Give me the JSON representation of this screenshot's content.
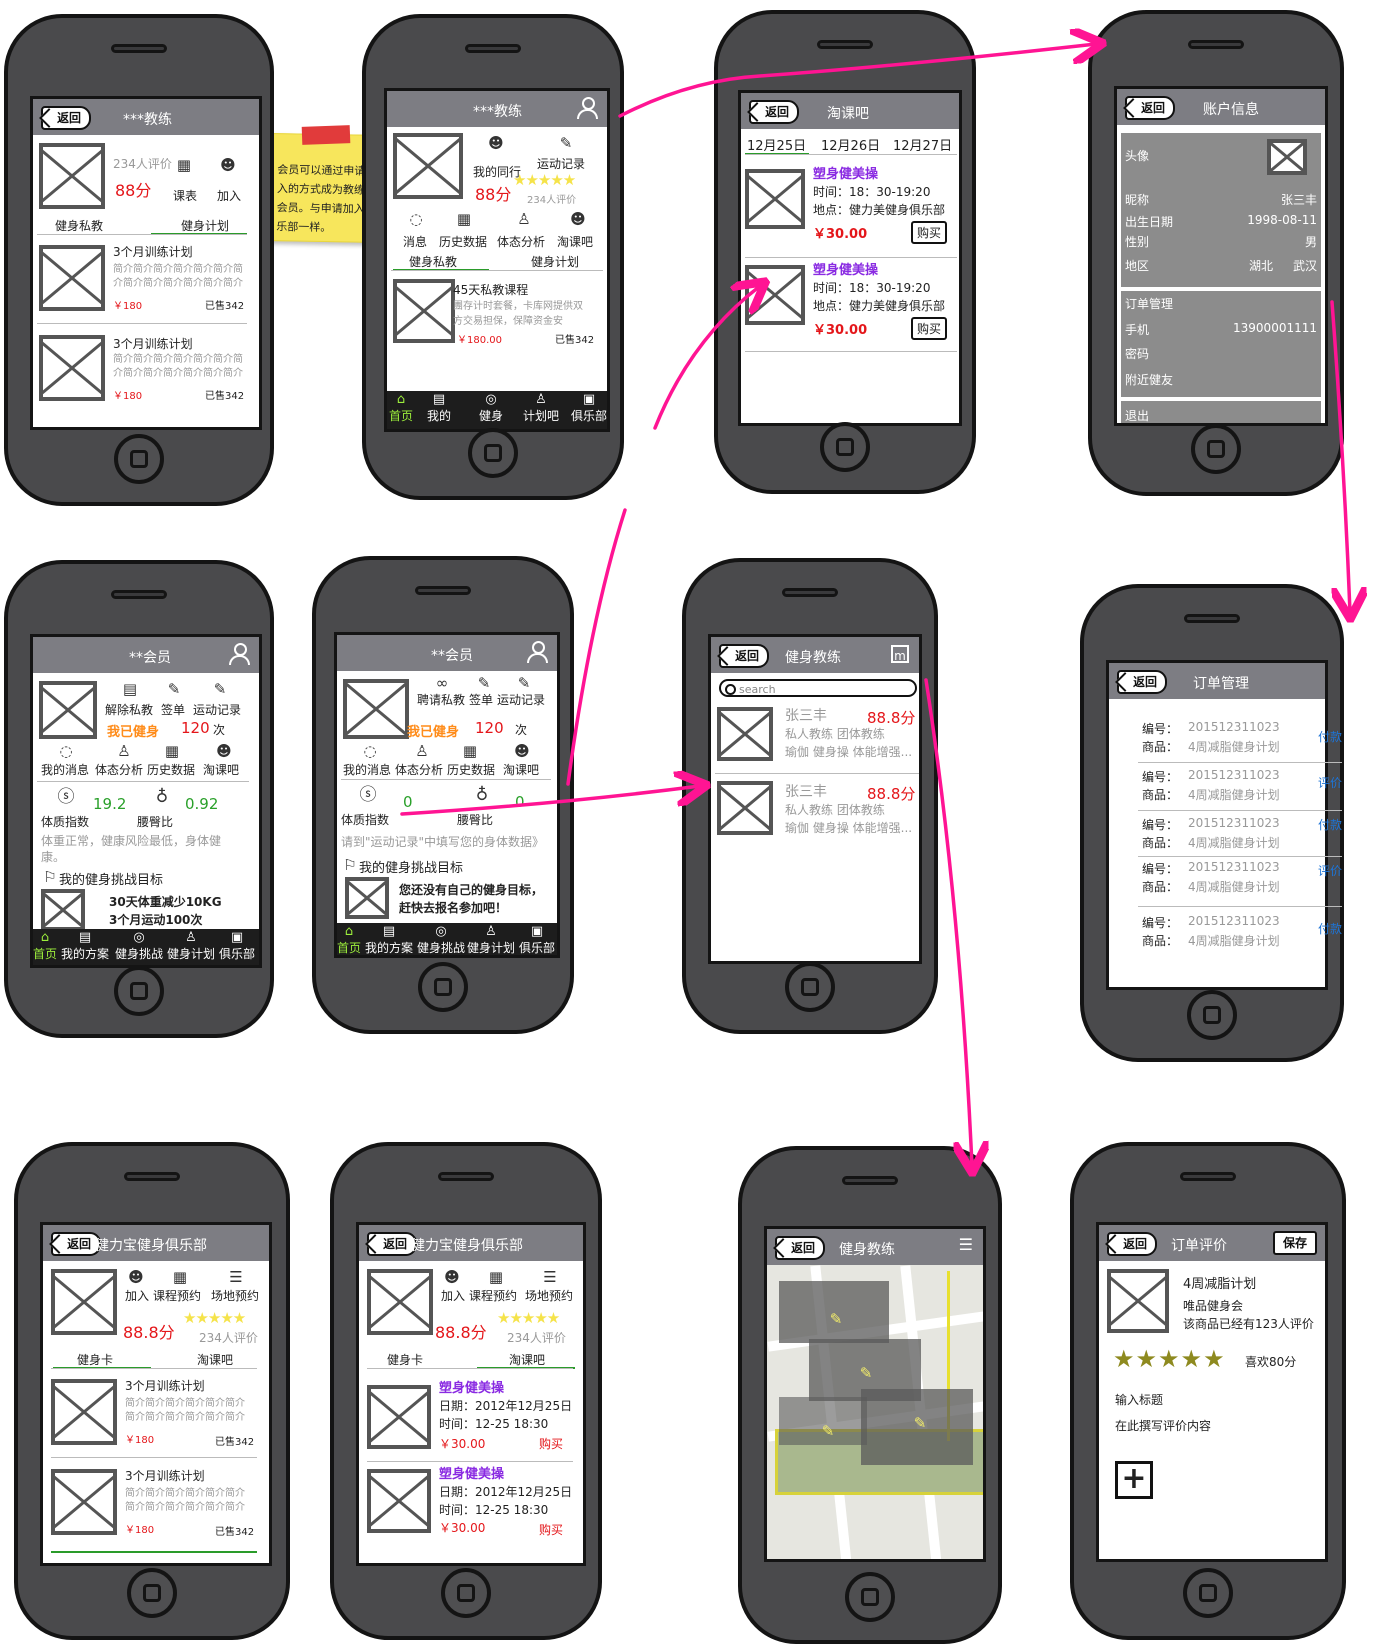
{
  "colors": {
    "accent": "#e4161a",
    "arrow": "#ff1493",
    "header": "#7d7d83",
    "tab_active": "#2a9b2a",
    "purple": "#8a2be2",
    "orange": "#ff8c1a",
    "star": "#f5e34a"
  },
  "common": {
    "back": "返回",
    "placeholder_icon": "image-placeholder-icon"
  },
  "note": "会员可以通过申请加入的方式成为教练的会员。与申请加入俱乐部一样。",
  "s1": {
    "title": "***教练",
    "reviews": "234人评价",
    "score": "88分",
    "schedule": "课表",
    "join": "加入",
    "tab1": "健身私教",
    "tab2": "健身计划",
    "items": [
      {
        "title": "3个月训练计划",
        "desc": "简介简介简介简介简介简介简介简介简介简介简介简介简介简介简介简介简介简介",
        "price": "￥180",
        "sold": "已售342"
      },
      {
        "title": "3个月训练计划",
        "desc": "简介简介简介简介简介简介简介简介简介简介简介简介简介简介简介简介简介简介",
        "price": "￥180",
        "sold": "已售342"
      }
    ]
  },
  "s2": {
    "title": "***教练",
    "peers": "我的同行",
    "record": "运动记录",
    "score": "88分",
    "reviews": "234人评价",
    "msg": "消息",
    "history": "历史数据",
    "body": "体态分析",
    "tao": "淘课吧",
    "tab1": "健身私教",
    "tab2": "健身计划",
    "course": "45天私教课程",
    "cdesc": "團存计时套餐，卡库网提供双方交易担保，保障资金安",
    "price": "￥180.00",
    "sold": "已售342",
    "bar": [
      "首页",
      "我的",
      "健身",
      "计划吧",
      "俱乐部"
    ]
  },
  "s3": {
    "title": "淘课吧",
    "dates": [
      "12月25日",
      "12月26日",
      "12月27日"
    ],
    "items": [
      {
        "name": "塑身健美操",
        "time": "时间：18：30-19:20",
        "place": "地点：健力美健身俱乐部",
        "price": "￥30.00",
        "buy": "购买"
      },
      {
        "name": "塑身健美操",
        "time": "时间：18：30-19:20",
        "place": "地点：健力美健身俱乐部",
        "price": "￥30.00",
        "buy": "购买"
      }
    ]
  },
  "s4": {
    "title": "账户信息",
    "avatar": "头像",
    "nick_l": "昵称",
    "nick": "张三丰",
    "birth_l": "出生日期",
    "birth": "1998-08-11",
    "sex_l": "性别",
    "sex": "男",
    "region_l": "地区",
    "region1": "湖北",
    "region2": "武汉",
    "orders": "订单管理",
    "phone_l": "手机",
    "phone": "13900001111",
    "pwd": "密码",
    "nearby": "附近健友",
    "logout": "退出"
  },
  "s5": {
    "title": "**会员",
    "cancel": "解除私教",
    "sign": "签单",
    "record": "运动记录",
    "self": "我已健身",
    "count": "120",
    "unit": "次",
    "msg": "我的消息",
    "body": "体态分析",
    "history": "历史数据",
    "tao": "淘课吧",
    "bmi": "19.2",
    "bmi_l": "体质指数",
    "whr": "0.92",
    "whr_l": "腰臀比",
    "advice": "体重正常，健康风险最低，身体健康。",
    "goal_t": "我的健身挑战目标",
    "goal1": "30天体重减少10KG",
    "goal2": "3个月运动100次",
    "bar": [
      "首页",
      "我的方案",
      "健身挑战",
      "健身计划",
      "俱乐部"
    ]
  },
  "s6": {
    "title": "**会员",
    "hire": "聘请私教",
    "sign": "签单",
    "record": "运动记录",
    "self": "我已健身",
    "count": "120",
    "unit": "次",
    "msg": "我的消息",
    "body": "体态分析",
    "history": "历史数据",
    "tao": "淘课吧",
    "bmi": "0",
    "bmi_l": "体质指数",
    "whr": "0",
    "whr_l": "腰臀比",
    "hint": "请到\"运动记录\"中填写您的身体数据》",
    "goal_t": "我的健身挑战目标",
    "goal": "您还没有自己的健身目标，赶快去报名参加吧！",
    "bar": [
      "首页",
      "我的方案",
      "健身挑战",
      "健身计划",
      "俱乐部"
    ]
  },
  "s7": {
    "title": "健身教练",
    "search": "search",
    "items": [
      {
        "name": "张三丰",
        "score": "88.8分",
        "tags": "私人教练  团体教练",
        "skills": "瑜伽  健身操  体能增强..."
      },
      {
        "name": "张三丰",
        "score": "88.8分",
        "tags": "私人教练  团体教练",
        "skills": "瑜伽  健身操  体能增强..."
      }
    ]
  },
  "s8": {
    "title": "订单管理",
    "no_l": "编号：",
    "goods_l": "商品：",
    "items": [
      {
        "no": "201512311023",
        "goods": "4周减脂健身计划",
        "action": "付款"
      },
      {
        "no": "201512311023",
        "goods": "4周减脂健身计划",
        "action": "评价"
      },
      {
        "no": "201512311023",
        "goods": "4周减脂健身计划",
        "action": "付款"
      },
      {
        "no": "201512311023",
        "goods": "4周减脂健身计划",
        "action": "评价"
      },
      {
        "no": "201512311023",
        "goods": "4周减脂健身计划",
        "action": "付款"
      }
    ]
  },
  "s9": {
    "title": "健力宝健身俱乐部",
    "join": "加入",
    "booking": "课程预约",
    "venue": "场地预约",
    "score": "88.8分",
    "reviews": "234人评价",
    "tab1": "健身卡",
    "tab2": "淘课吧",
    "items": [
      {
        "title": "3个月训练计划",
        "desc": "简介简介简介简介简介简介简介简介简介简介简介简介简介简介简介简介简介简介",
        "price": "￥180",
        "sold": "已售342"
      },
      {
        "title": "3个月训练计划",
        "desc": "简介简介简介简介简介简介简介简介简介简介简介简介简介简介简介简介简介简介",
        "price": "￥180",
        "sold": "已售342"
      }
    ]
  },
  "s10": {
    "title": "健力宝健身俱乐部",
    "join": "加入",
    "booking": "课程预约",
    "venue": "场地预约",
    "score": "88.8分",
    "reviews": "234人评价",
    "tab1": "健身卡",
    "tab2": "淘课吧",
    "items": [
      {
        "name": "塑身健美操",
        "date": "日期：2012年12月25日",
        "time": "时间：12-25 18:30",
        "price": "￥30.00",
        "buy": "购买"
      },
      {
        "name": "塑身健美操",
        "date": "日期：2012年12月25日",
        "time": "时间：12-25 18:30",
        "price": "￥30.00",
        "buy": "购买"
      }
    ]
  },
  "s11": {
    "title": "健身教练"
  },
  "s12": {
    "title": "订单评价",
    "save": "保存",
    "product": "4周减脂计划",
    "shop": "唯品健身会",
    "count": "该商品已经有123人评价",
    "rating": "喜欢80分",
    "input_title": "输入标题",
    "input_body": "在此撰写评价内容"
  }
}
